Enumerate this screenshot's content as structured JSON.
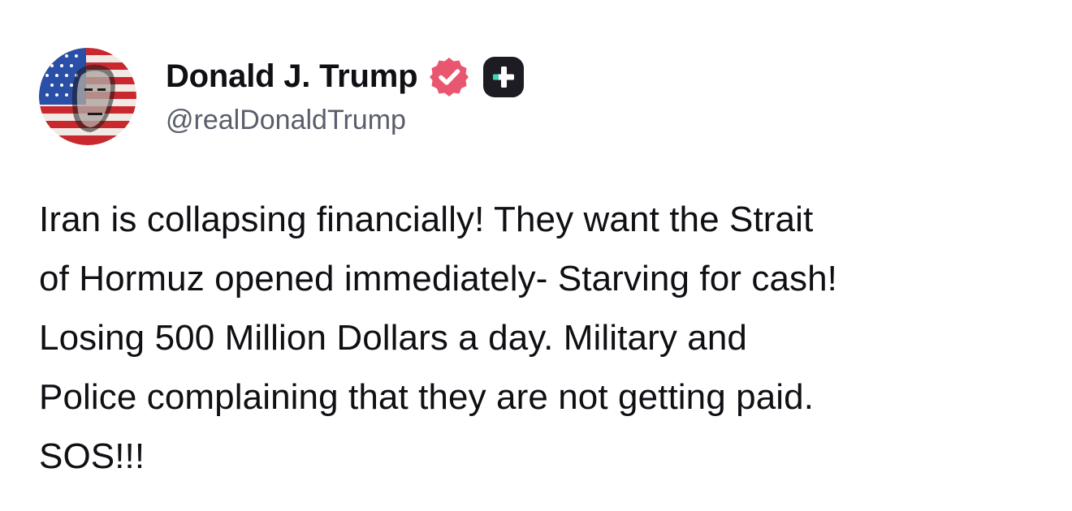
{
  "post": {
    "author": {
      "display_name": "Donald J. Trump",
      "handle": "@realDonaldTrump",
      "avatar_icon": "flag-portrait-avatar",
      "badges": [
        "verified-badge-icon",
        "plus-badge-icon"
      ]
    },
    "text": "Iran is collapsing financially! They want the Strait\nof Hormuz opened immediately- Starving for cash!\nLosing 500 Million Dollars a day. Military and\nPolice complaining that they are not getting paid.\nSOS!!!"
  },
  "colors": {
    "background": "#ffffff",
    "text": "#0f0f14",
    "handle": "#5a5e6b",
    "verified_badge": "#e9566f",
    "plus_badge_bg": "#1c1c22",
    "plus_badge_accent": "#3ad6b0"
  }
}
